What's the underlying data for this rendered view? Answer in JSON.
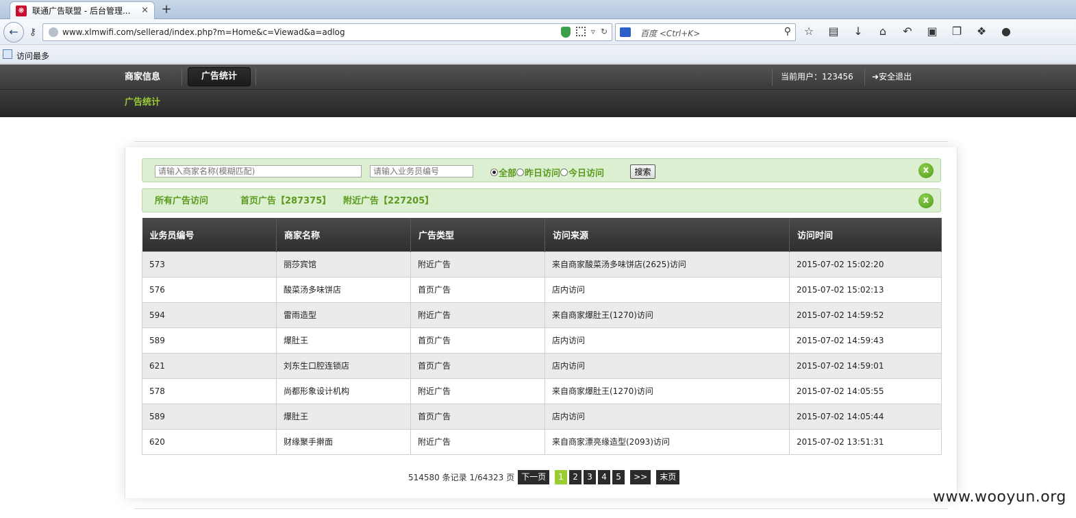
{
  "browser": {
    "tab_title": "联通广告联盟 - 后台管理...",
    "tab_close": "✕",
    "new_tab": "+",
    "url": "www.xlmwifi.com/sellerad/index.php?m=Home&c=Viewad&a=adlog",
    "search_placeholder": "百度 <Ctrl+K>",
    "bookmark_label": "访问最多"
  },
  "site": {
    "nav": [
      "商家信息",
      "广告统计"
    ],
    "current_user": "当前用户：123456",
    "logout": "安全退出",
    "sub_nav": "广告统计"
  },
  "filters": {
    "merchant_placeholder": "请输入商家名称(模糊匹配)",
    "staff_placeholder": "请输入业务员编号",
    "radio_options": [
      "全部",
      "昨日访问",
      "今日访问"
    ],
    "selected": "全部",
    "search_button": "搜索",
    "close": "x"
  },
  "summary": {
    "all": "所有广告访问",
    "home": "首页广告【287375】",
    "nearby": "附近广告【227205】",
    "close": "x"
  },
  "table": {
    "headers": [
      "业务员编号",
      "商家名称",
      "广告类型",
      "访问来源",
      "访问时间"
    ],
    "rows": [
      [
        "573",
        "丽莎宾馆",
        "附近广告",
        "来自商家酸菜汤多味饼店(2625)访问",
        "2015-07-02 15:02:20"
      ],
      [
        "576",
        "酸菜汤多味饼店",
        "首页广告",
        "店内访问",
        "2015-07-02 15:02:13"
      ],
      [
        "594",
        "雷雨造型",
        "附近广告",
        "来自商家爆肚王(1270)访问",
        "2015-07-02 14:59:52"
      ],
      [
        "589",
        "爆肚王",
        "首页广告",
        "店内访问",
        "2015-07-02 14:59:43"
      ],
      [
        "621",
        "刘东生口腔连锁店",
        "首页广告",
        "店内访问",
        "2015-07-02 14:59:01"
      ],
      [
        "578",
        "尚都形象设计机构",
        "附近广告",
        "来自商家爆肚王(1270)访问",
        "2015-07-02 14:05:55"
      ],
      [
        "589",
        "爆肚王",
        "首页广告",
        "店内访问",
        "2015-07-02 14:05:44"
      ],
      [
        "620",
        "财缘聚手擀面",
        "附近广告",
        "来自商家漂亮缘造型(2093)访问",
        "2015-07-02 13:51:31"
      ]
    ]
  },
  "pager": {
    "summary": "514580 条记录 1/64323 页",
    "next": "下一页",
    "pages": [
      "1",
      "2",
      "3",
      "4",
      "5"
    ],
    "current": "1",
    "more": ">>",
    "last": "末页"
  },
  "watermark": "www.wooyun.org",
  "colors": {
    "accent_green": "#9acd32",
    "filter_bg": "#dcefd0",
    "header_dark": "#3a3a3a"
  }
}
